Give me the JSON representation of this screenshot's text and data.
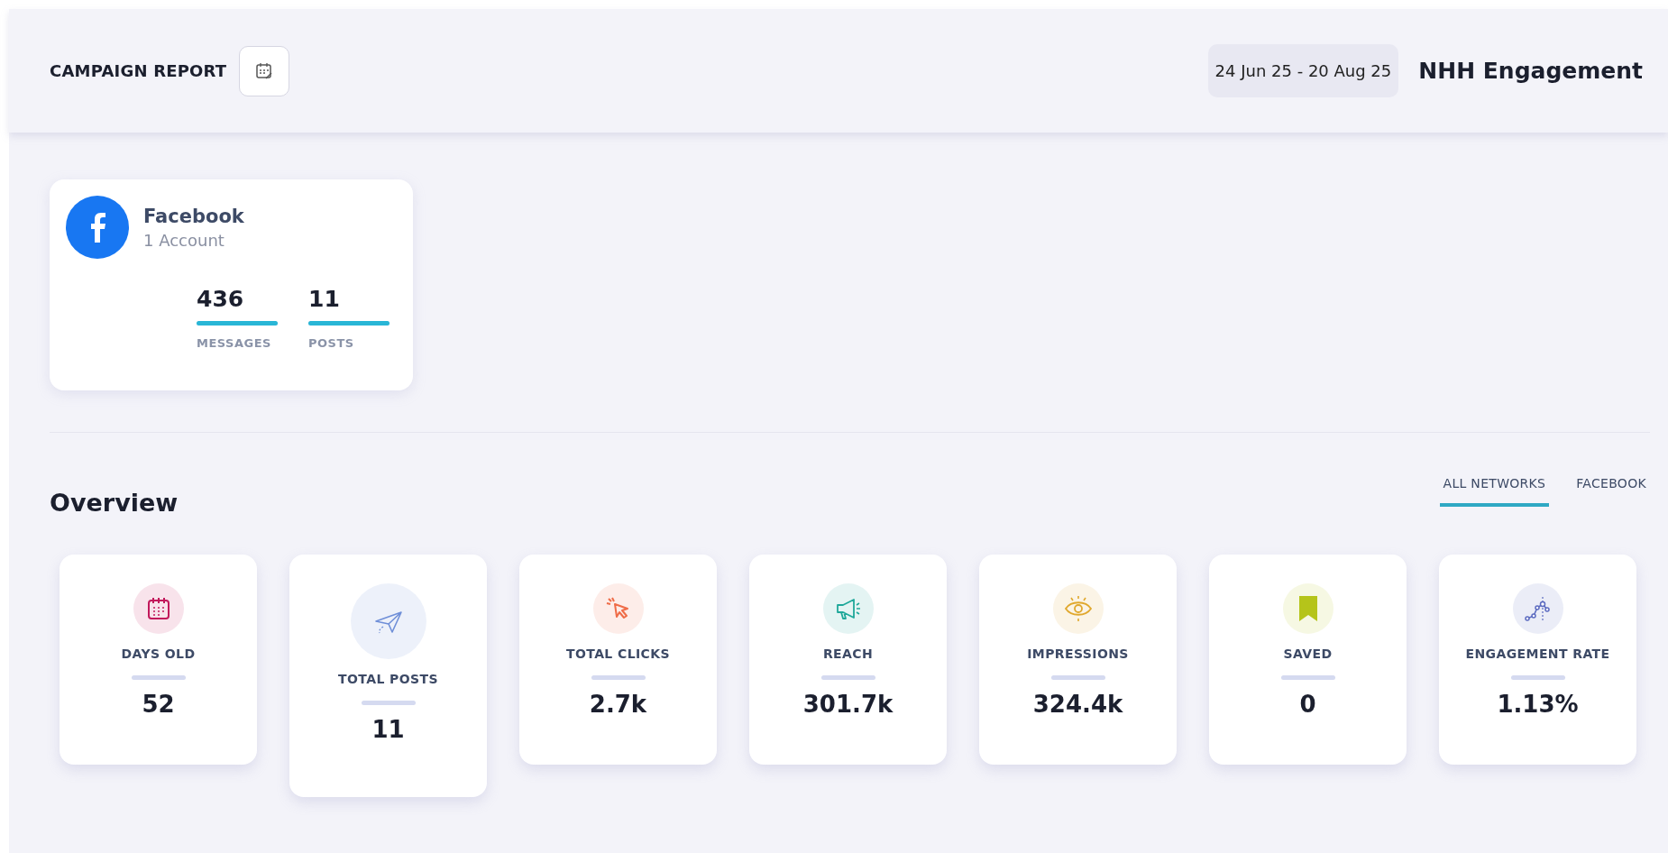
{
  "header": {
    "title": "CAMPAIGN REPORT",
    "date_range": "24 Jun 25 - 20 Aug 25",
    "campaign_name": "NHH Engagement"
  },
  "network_card": {
    "name": "Facebook",
    "accounts": "1 Account",
    "stats": [
      {
        "value": "436",
        "label": "MESSAGES",
        "level": 1
      },
      {
        "value": "11",
        "label": "POSTS",
        "level": 1
      }
    ]
  },
  "overview": {
    "title": "Overview",
    "tabs": [
      {
        "label": "ALL NETWORKS",
        "selected": true
      },
      {
        "label": "FACEBOOK",
        "selected": false
      }
    ],
    "metrics": [
      {
        "kind": "calendar",
        "color": "#c2185b",
        "label": "DAYS OLD",
        "value": "52",
        "selected": false
      },
      {
        "kind": "plane",
        "color": "#6f8fd8",
        "label": "TOTAL POSTS",
        "value": "11",
        "selected": true
      },
      {
        "kind": "cursor",
        "color": "#ef6c48",
        "label": "TOTAL CLICKS",
        "value": "2.7k",
        "selected": false
      },
      {
        "kind": "megaphone",
        "color": "#1fa89a",
        "label": "REACH",
        "value": "301.7k",
        "selected": false
      },
      {
        "kind": "eye",
        "color": "#e0a82e",
        "label": "IMPRESSIONS",
        "value": "324.4k",
        "selected": false
      },
      {
        "kind": "bookmark",
        "color": "#b5c41a",
        "label": "SAVED",
        "value": "0",
        "selected": false
      },
      {
        "kind": "chart",
        "color": "#5c6bc0",
        "label": "ENGAGEMENT RATE",
        "value": "1.13%",
        "selected": false
      }
    ]
  }
}
